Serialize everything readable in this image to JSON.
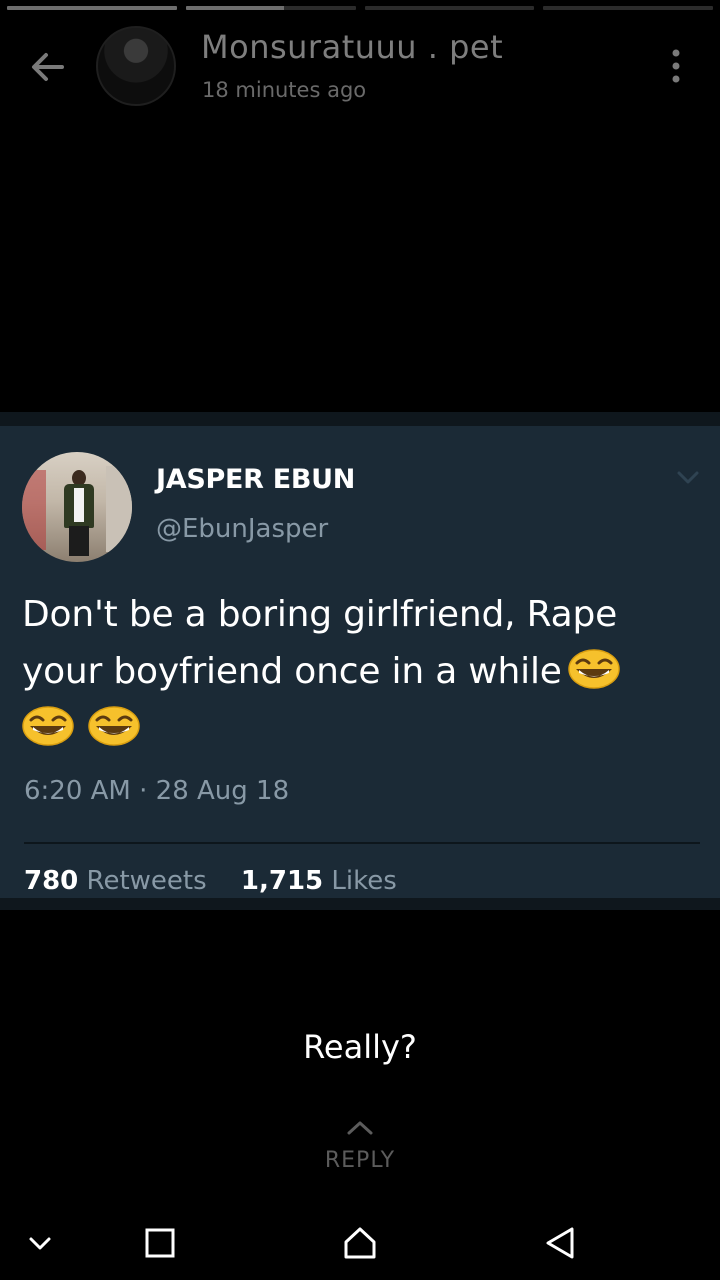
{
  "story": {
    "progress_fill": [
      1.0,
      0.58,
      0.0,
      0.0
    ],
    "poster_name": "Monsuratuuu . pet",
    "posted_time": "18 minutes ago"
  },
  "tweet": {
    "display_name": "JASPER EBUN",
    "handle": "@EbunJasper",
    "text": "Don't be a boring girlfriend, Rape your boyfriend once in a while",
    "emoji_icon": "grinning-face-with-smiling-eyes",
    "timestamp": "6:20 AM · 28 Aug 18",
    "retweets_count": "780",
    "retweets_label": "Retweets",
    "likes_count": "1,715",
    "likes_label": "Likes"
  },
  "caption": "Really?",
  "reply_label": "REPLY",
  "icons": {
    "back": "arrow-left-icon",
    "more": "more-vertical-icon",
    "tweet_menu": "chevron-down-icon",
    "reply": "chevron-up-icon",
    "nav_collapse": "chevron-down-icon",
    "nav_recents": "square-icon",
    "nav_home": "home-icon",
    "nav_back": "triangle-back-icon"
  },
  "colors": {
    "tweet_background": "#1b2a36",
    "secondary_text": "#8899a6"
  }
}
